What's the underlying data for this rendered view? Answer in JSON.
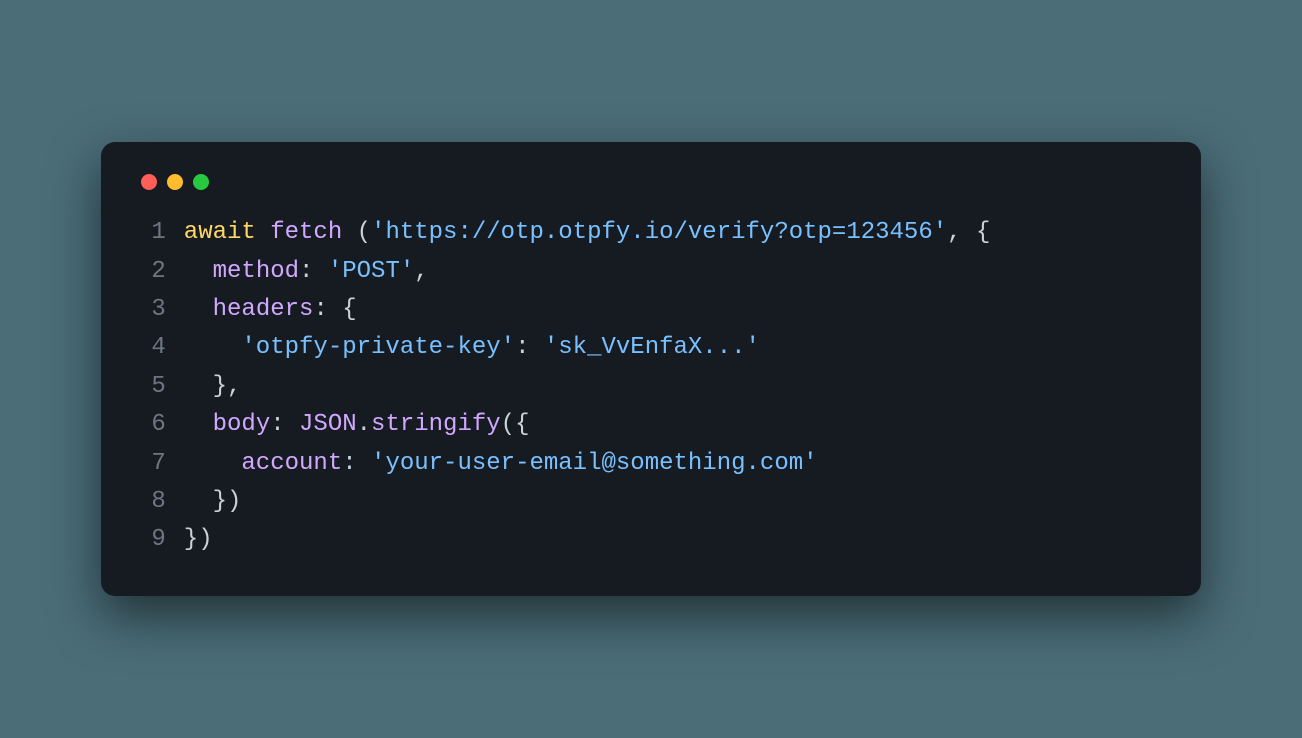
{
  "window": {
    "dots": [
      "red",
      "yellow",
      "green"
    ]
  },
  "code": {
    "lines": [
      {
        "num": "1",
        "tokens": [
          {
            "cls": "tok-kw",
            "t": "await"
          },
          {
            "cls": "tok-punc",
            "t": " "
          },
          {
            "cls": "tok-fn",
            "t": "fetch"
          },
          {
            "cls": "tok-punc",
            "t": " ("
          },
          {
            "cls": "tok-str",
            "t": "'https://otp.otpfy.io/verify?otp=123456'"
          },
          {
            "cls": "tok-punc",
            "t": ", {"
          }
        ]
      },
      {
        "num": "2",
        "tokens": [
          {
            "cls": "tok-punc",
            "t": "  "
          },
          {
            "cls": "tok-fn",
            "t": "method"
          },
          {
            "cls": "tok-punc",
            "t": ": "
          },
          {
            "cls": "tok-str",
            "t": "'POST'"
          },
          {
            "cls": "tok-punc",
            "t": ","
          }
        ]
      },
      {
        "num": "3",
        "tokens": [
          {
            "cls": "tok-punc",
            "t": "  "
          },
          {
            "cls": "tok-fn",
            "t": "headers"
          },
          {
            "cls": "tok-punc",
            "t": ": {"
          }
        ]
      },
      {
        "num": "4",
        "tokens": [
          {
            "cls": "tok-punc",
            "t": "    "
          },
          {
            "cls": "tok-str",
            "t": "'otpfy-private-key'"
          },
          {
            "cls": "tok-punc",
            "t": ": "
          },
          {
            "cls": "tok-str",
            "t": "'sk_VvEnfaX...'"
          }
        ]
      },
      {
        "num": "5",
        "tokens": [
          {
            "cls": "tok-punc",
            "t": "  },"
          }
        ]
      },
      {
        "num": "6",
        "tokens": [
          {
            "cls": "tok-punc",
            "t": "  "
          },
          {
            "cls": "tok-fn",
            "t": "body"
          },
          {
            "cls": "tok-punc",
            "t": ": "
          },
          {
            "cls": "tok-fn",
            "t": "JSON"
          },
          {
            "cls": "tok-punc",
            "t": "."
          },
          {
            "cls": "tok-fn",
            "t": "stringify"
          },
          {
            "cls": "tok-punc",
            "t": "({"
          }
        ]
      },
      {
        "num": "7",
        "tokens": [
          {
            "cls": "tok-punc",
            "t": "    "
          },
          {
            "cls": "tok-fn",
            "t": "account"
          },
          {
            "cls": "tok-punc",
            "t": ": "
          },
          {
            "cls": "tok-str",
            "t": "'your-user-email@something.com'"
          }
        ]
      },
      {
        "num": "8",
        "tokens": [
          {
            "cls": "tok-punc",
            "t": "  })"
          }
        ]
      },
      {
        "num": "9",
        "tokens": [
          {
            "cls": "tok-punc",
            "t": "})"
          }
        ]
      }
    ]
  }
}
